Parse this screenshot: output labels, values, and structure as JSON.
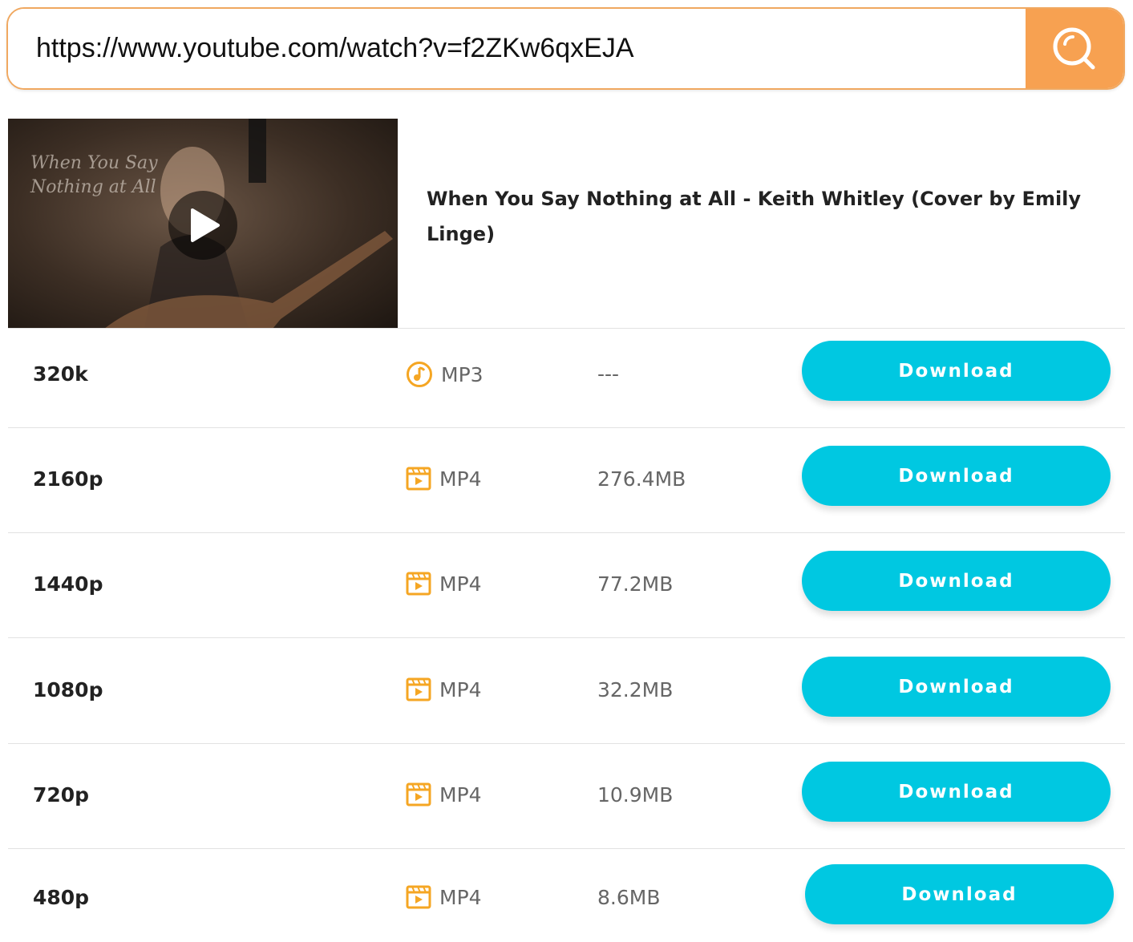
{
  "search": {
    "value": "https://www.youtube.com/watch?v=f2ZKw6qxEJA",
    "icon": "search-icon",
    "accent": "#f7a151"
  },
  "video": {
    "title": "When You Say Nothing at All - Keith Whitley (Cover by Emily Linge)",
    "thumbnail_text": "When You Say Nothing at All"
  },
  "download_color": "#00c8e1",
  "rows": [
    {
      "quality": "320k",
      "format": "MP3",
      "icon": "music-note-icon",
      "size": "---",
      "button": "Download"
    },
    {
      "quality": "2160p",
      "format": "MP4",
      "icon": "video-icon",
      "size": "276.4MB",
      "button": "Download"
    },
    {
      "quality": "1440p",
      "format": "MP4",
      "icon": "video-icon",
      "size": "77.2MB",
      "button": "Download"
    },
    {
      "quality": "1080p",
      "format": "MP4",
      "icon": "video-icon",
      "size": "32.2MB",
      "button": "Download"
    },
    {
      "quality": "720p",
      "format": "MP4",
      "icon": "video-icon",
      "size": "10.9MB",
      "button": "Download"
    },
    {
      "quality": "480p",
      "format": "MP4",
      "icon": "video-icon",
      "size": "8.6MB",
      "button": "Download"
    }
  ]
}
